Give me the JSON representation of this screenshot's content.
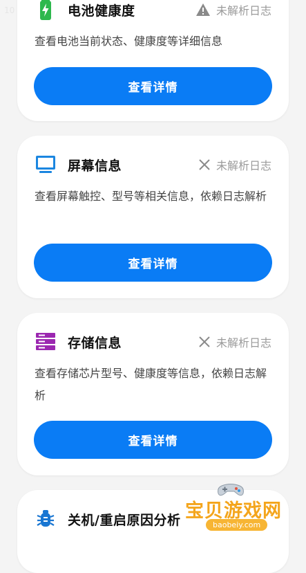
{
  "status_bar": {
    "time_fragment": "10"
  },
  "cards": [
    {
      "title": "电池健康度",
      "icon": "battery-charging-icon",
      "status_label": "未解析日志",
      "status_icon": "warning-icon",
      "description": "查看电池当前状态、健康度等详细信息",
      "button_label": "查看详情"
    },
    {
      "title": "屏幕信息",
      "icon": "monitor-icon",
      "status_label": "未解析日志",
      "status_icon": "close-icon",
      "description": "查看屏幕触控、型号等相关信息，依赖日志解析",
      "button_label": "查看详情"
    },
    {
      "title": "存储信息",
      "icon": "storage-icon",
      "status_label": "未解析日志",
      "status_icon": "close-icon",
      "description": "查看存储芯片型号、健康度等信息，依赖日志解析",
      "button_label": "查看详情"
    },
    {
      "title": "关机/重启原因分析",
      "icon": "bug-icon"
    }
  ],
  "watermark": {
    "text": "宝贝游戏网",
    "subtext": "baobeiy.com"
  },
  "colors": {
    "accent": "#0a7cf5",
    "battery_green": "#2db84d",
    "monitor_blue": "#1b86e0",
    "storage_purple": "#9b27b0",
    "bug_blue": "#1976d2",
    "status_gray": "#9a9a9a",
    "background": "#f4f4f4"
  }
}
